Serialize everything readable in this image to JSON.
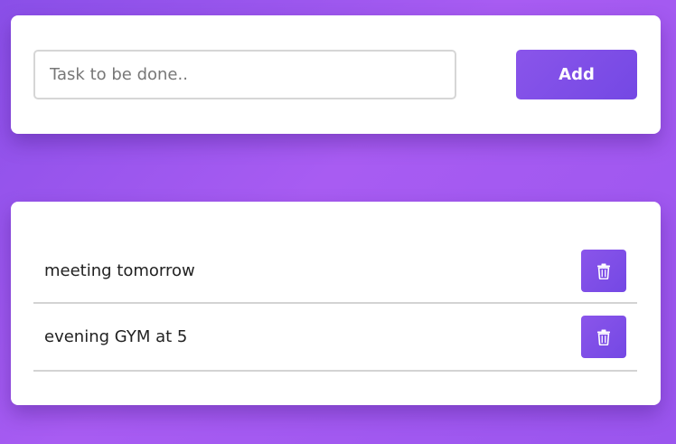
{
  "input_form": {
    "placeholder": "Task to be done..",
    "value": "",
    "add_label": "Add"
  },
  "tasks": [
    {
      "text": "meeting tomorrow",
      "action_icon": "trash-icon"
    },
    {
      "text": "evening GYM at 5",
      "action_icon": "trash-icon"
    }
  ],
  "colors": {
    "background": "#9a55ee",
    "accent": "#7e4fe6",
    "card": "#ffffff"
  }
}
